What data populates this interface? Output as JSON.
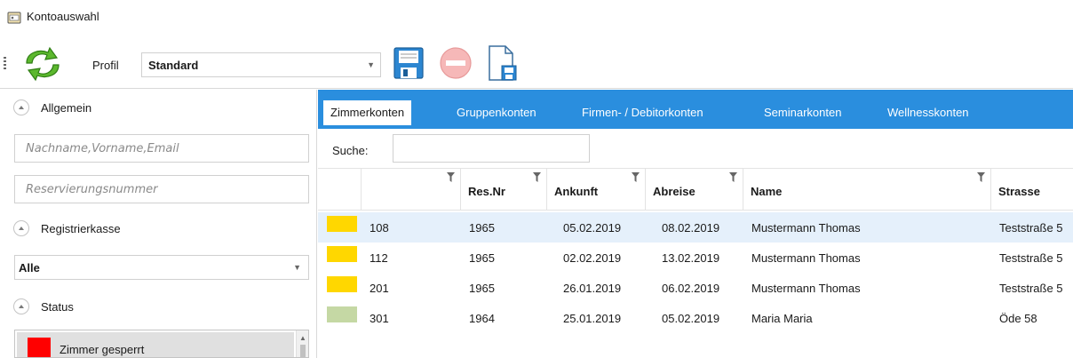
{
  "window": {
    "title": "Kontoauswahl"
  },
  "toolbar": {
    "refresh_icon": "refresh-icon",
    "profil_label": "Profil",
    "profil_value": "Standard",
    "save_icon": "save-icon",
    "remove_icon": "remove-icon",
    "export_icon": "export-icon"
  },
  "filters": {
    "allgemein": "Allgemein",
    "name_placeholder": "Nachname,Vorname,Email",
    "reservation_placeholder": "Reservierungsnummer",
    "registrierkasse": "Registrierkasse",
    "kasse_value": "Alle",
    "status": "Status",
    "status_items": [
      {
        "label": "Zimmer gesperrt",
        "color": "#ff0000"
      }
    ]
  },
  "tabs": [
    {
      "label": "Zimmerkonten",
      "active": true
    },
    {
      "label": "Gruppenkonten",
      "active": false
    },
    {
      "label": "Firmen- / Debitorkonten",
      "active": false
    },
    {
      "label": "Seminarkonten",
      "active": false
    },
    {
      "label": "Wellnesskonten",
      "active": false
    }
  ],
  "search": {
    "label": "Suche:",
    "value": ""
  },
  "table": {
    "columns": [
      "",
      "Res.Nr",
      "Ankunft",
      "Abreise",
      "Name",
      "Strasse"
    ],
    "rows": [
      {
        "color": "#ffd700",
        "zimmer": "108",
        "resnr": "1965",
        "ankunft": "05.02.2019",
        "abreise": "08.02.2019",
        "name": "Mustermann Thomas",
        "strasse": "Teststraße 5",
        "selected": true
      },
      {
        "color": "#ffd700",
        "zimmer": "112",
        "resnr": "1965",
        "ankunft": "02.02.2019",
        "abreise": "13.02.2019",
        "name": "Mustermann Thomas",
        "strasse": "Teststraße 5",
        "selected": false
      },
      {
        "color": "#ffd700",
        "zimmer": "201",
        "resnr": "1965",
        "ankunft": "26.01.2019",
        "abreise": "06.02.2019",
        "name": "Mustermann Thomas",
        "strasse": "Teststraße 5",
        "selected": false
      },
      {
        "color": "#c5d8a4",
        "zimmer": "301",
        "resnr": "1964",
        "ankunft": "25.01.2019",
        "abreise": "05.02.2019",
        "name": "Maria Maria",
        "strasse": "Öde 58",
        "selected": false
      }
    ]
  },
  "colors": {
    "accent": "#2a8ede",
    "selected_row": "#e5f0fb"
  }
}
